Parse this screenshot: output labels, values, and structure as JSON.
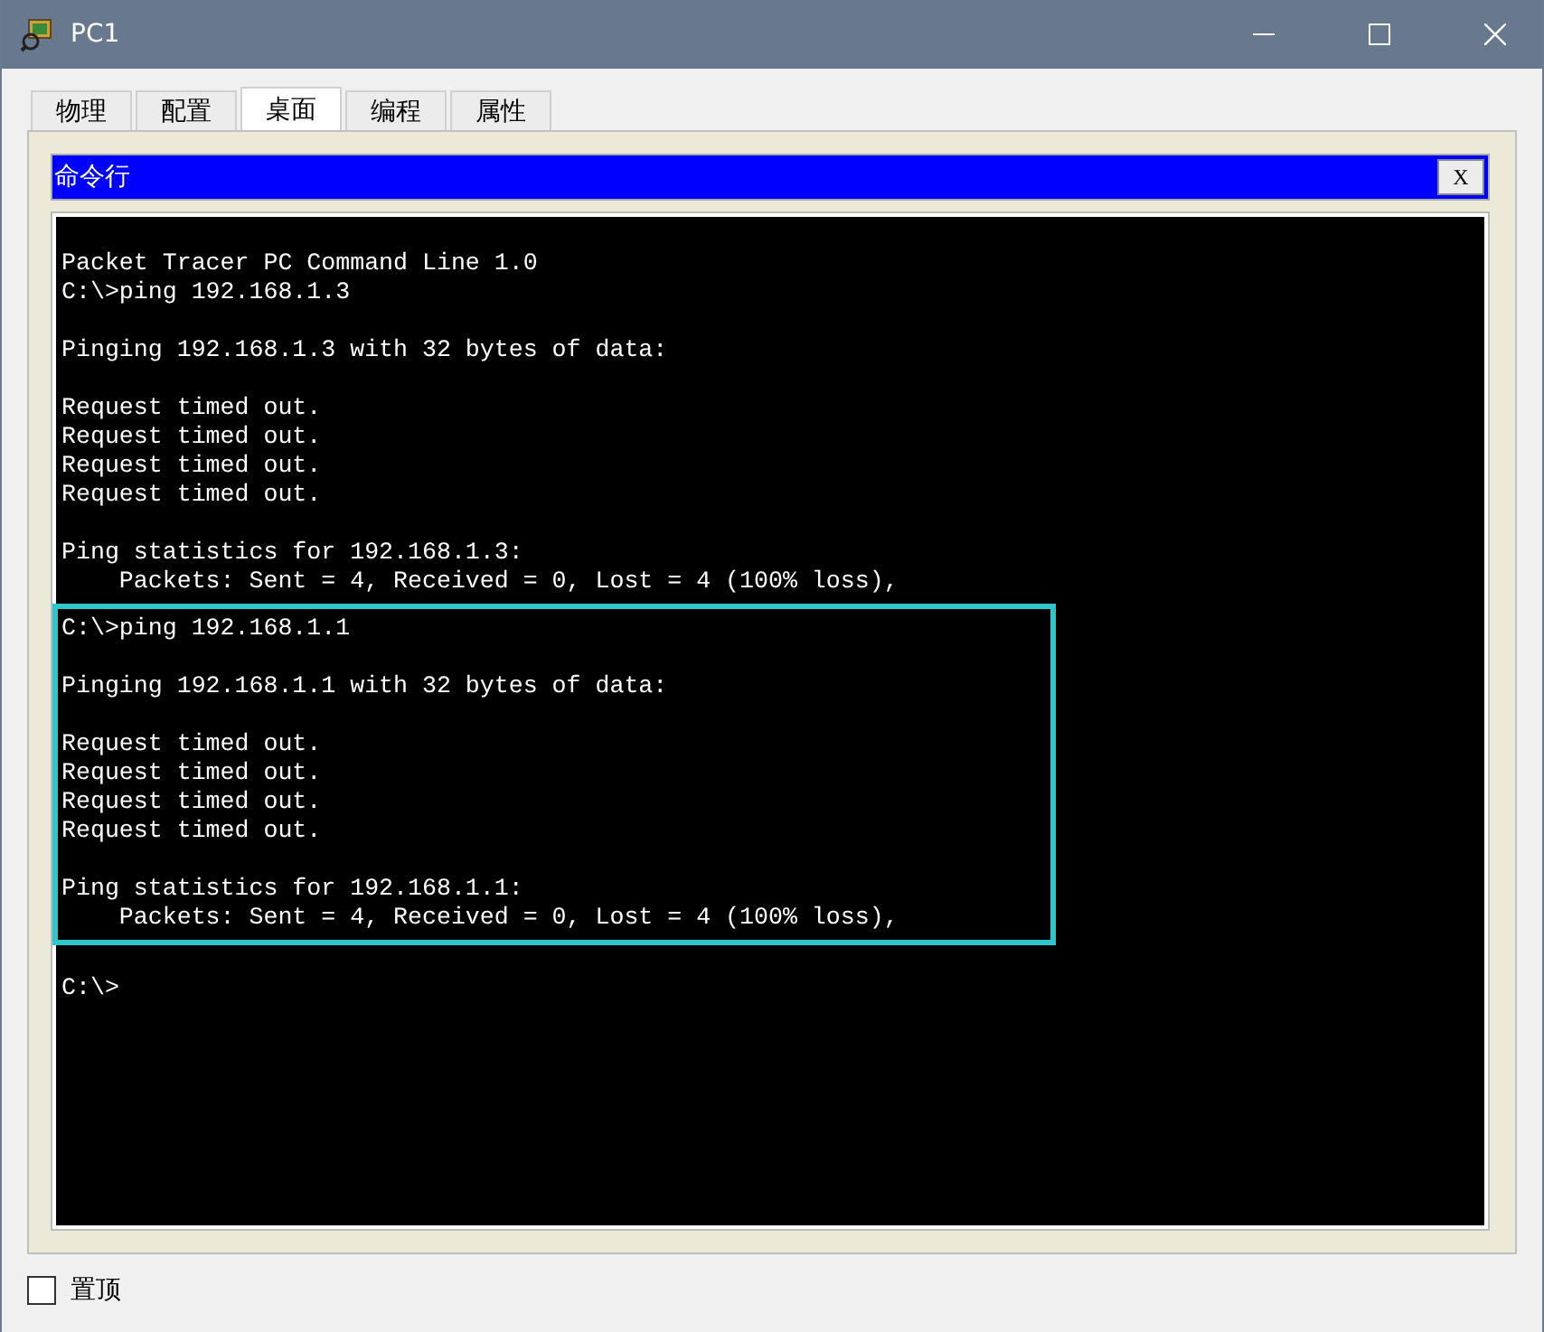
{
  "window": {
    "title": "PC1"
  },
  "tabs": [
    {
      "label": "物理",
      "selected": false
    },
    {
      "label": "配置",
      "selected": false
    },
    {
      "label": "桌面",
      "selected": true
    },
    {
      "label": "编程",
      "selected": false
    },
    {
      "label": "属性",
      "selected": false
    }
  ],
  "app_bar": {
    "title": "命令行",
    "close": "X"
  },
  "terminal": {
    "sections": [
      {
        "highlighted": false,
        "paragraphs": [
          [
            "Packet Tracer PC Command Line 1.0",
            "C:\\>ping 192.168.1.3"
          ],
          [
            "Pinging 192.168.1.3 with 32 bytes of data:"
          ],
          [
            "Request timed out.",
            "Request timed out.",
            "Request timed out.",
            "Request timed out."
          ],
          [
            "Ping statistics for 192.168.1.3:",
            "    Packets: Sent = 4, Received = 0, Lost = 4 (100% loss),"
          ]
        ]
      },
      {
        "highlighted": true,
        "paragraphs": [
          [
            "C:\\>ping 192.168.1.1"
          ],
          [
            "Pinging 192.168.1.1 with 32 bytes of data:"
          ],
          [
            "Request timed out.",
            "Request timed out.",
            "Request timed out.",
            "Request timed out."
          ],
          [
            "Ping statistics for 192.168.1.1:",
            "    Packets: Sent = 4, Received = 0, Lost = 4 (100% loss),"
          ]
        ]
      },
      {
        "highlighted": false,
        "paragraphs": [
          [
            "C:\\>"
          ]
        ]
      }
    ]
  },
  "always_on_top": {
    "label": "置顶",
    "checked": false
  }
}
